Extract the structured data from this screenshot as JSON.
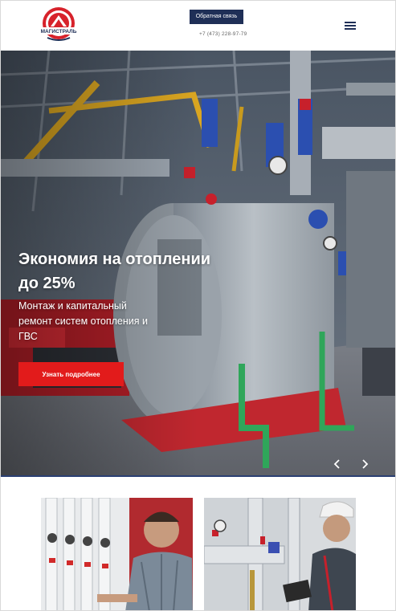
{
  "header": {
    "logo_text": "МАГИСТРАЛЬ",
    "feedback_button": "Обратная связь",
    "phone": "+7 (473) 228-97-79",
    "menu_icon": "hamburger-icon"
  },
  "hero": {
    "title": "Экономия на отоплении до 25%",
    "subtitle": "Монтаж и капитальный ремонт систем отопления и ГВС",
    "cta": "Узнать подробнее",
    "prev_icon": "chevron-left-icon",
    "next_icon": "chevron-right-icon"
  },
  "colors": {
    "brand_navy": "#1f2f57",
    "cta_red": "#e21b1b",
    "logo_red": "#d7222b"
  }
}
